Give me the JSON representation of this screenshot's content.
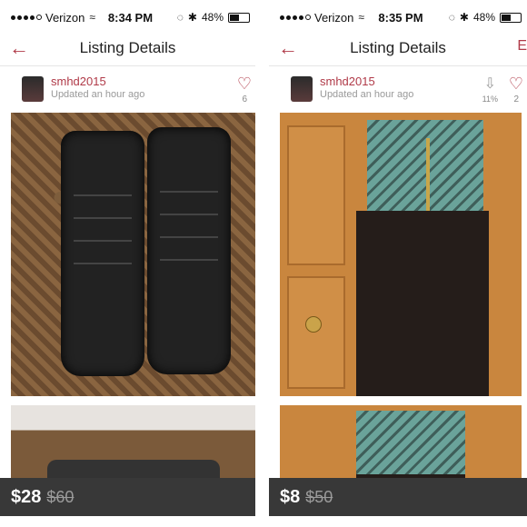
{
  "left": {
    "status": {
      "carrier": "Verizon",
      "time": "8:34 PM",
      "battery": "48%"
    },
    "nav": {
      "title": "Listing Details"
    },
    "user": {
      "name": "smhd2015",
      "updated": "Updated an hour ago"
    },
    "likes": {
      "count": "6"
    },
    "price": {
      "current": "$28",
      "original": "$60"
    }
  },
  "right": {
    "status": {
      "carrier": "Verizon",
      "time": "8:35 PM",
      "battery": "48%"
    },
    "nav": {
      "title": "Listing Details",
      "edge": "E"
    },
    "user": {
      "name": "smhd2015",
      "updated": "Updated an hour ago"
    },
    "price_drop": {
      "percent": "11%"
    },
    "likes": {
      "count": "2"
    },
    "price": {
      "current": "$8",
      "original": "$50"
    }
  },
  "icons": {
    "back": "back-arrow-icon",
    "heart": "heart-icon",
    "drop": "price-drop-icon"
  },
  "colors": {
    "accent": "#b03a48",
    "pricebar": "#383838"
  }
}
